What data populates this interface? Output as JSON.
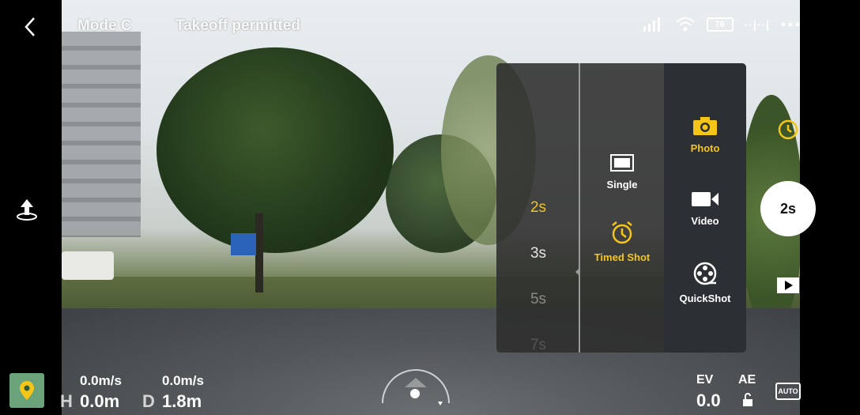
{
  "status": {
    "mode": "Mode C",
    "takeoff": "Takeoff permitted",
    "battery": "76",
    "signal_label": "··|··|"
  },
  "mode_panel": {
    "timer_options": [
      "2s",
      "3s",
      "5s",
      "7s"
    ],
    "timer_selected": "2s",
    "sub_modes": [
      {
        "label": "Single",
        "icon": "single-frame-icon",
        "active": false
      },
      {
        "label": "Timed Shot",
        "icon": "alarm-clock-icon",
        "active": true
      }
    ],
    "main_modes": [
      {
        "label": "Photo",
        "icon": "camera-icon",
        "active": true
      },
      {
        "label": "Video",
        "icon": "video-camera-icon",
        "active": false
      },
      {
        "label": "QuickShot",
        "icon": "film-reel-icon",
        "active": false
      }
    ]
  },
  "shutter": {
    "label": "2s"
  },
  "telemetry": {
    "h_speed": "0.0m/s",
    "d_speed": "0.0m/s",
    "h_label": "H",
    "h_value": "0.0m",
    "d_label": "D",
    "d_value": "1.8m"
  },
  "exposure": {
    "ev_label": "EV",
    "ev_value": "0.0",
    "ae_label": "AE",
    "auto_label": "AUTO"
  },
  "colors": {
    "accent": "#f5c518",
    "panel": "#2d2d2d"
  }
}
